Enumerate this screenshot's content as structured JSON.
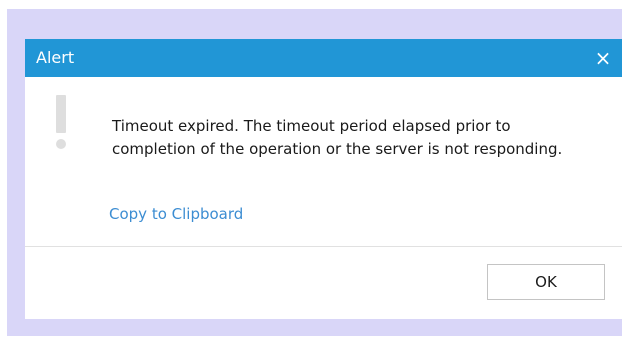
{
  "dialog": {
    "title": "Alert",
    "close_label": "×",
    "message": "Timeout expired.  The timeout period elapsed prior to completion of the operation or the server is not responding.",
    "copy_link_label": "Copy to Clipboard",
    "ok_label": "OK",
    "icon": "exclamation-icon"
  },
  "colors": {
    "titlebar": "#2196d6",
    "overlay": "#d9d6f8",
    "link": "#3c8dd2"
  }
}
